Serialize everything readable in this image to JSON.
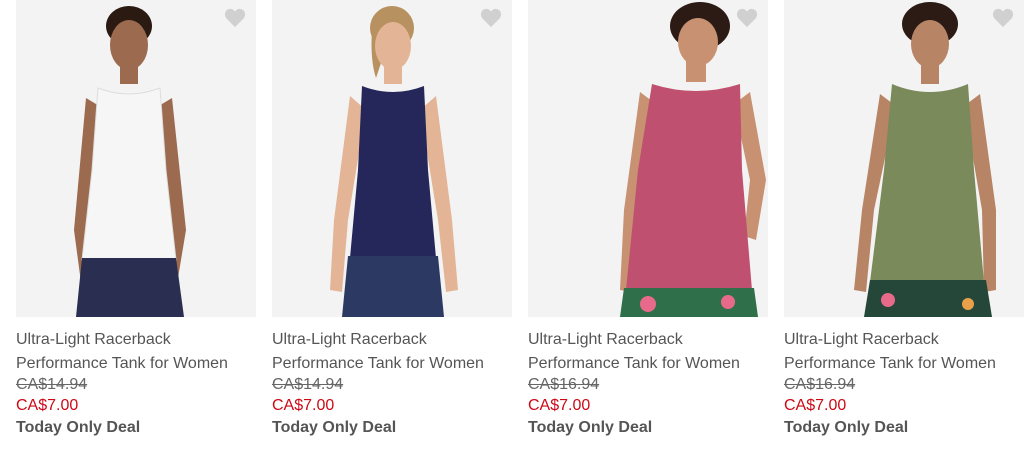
{
  "products": [
    {
      "name_line1": "Ultra-Light Racerback",
      "name_line2": "Performance Tank for Women",
      "was_price": "CA$14.94",
      "sale_price": "CA$7.00",
      "badge": "Today Only Deal",
      "tank_color": "#f6f6f6",
      "bottoms_color": "#2a2f52",
      "skin_color": "#9b6a4f",
      "hair_color": "#2a1a12"
    },
    {
      "name_line1": "Ultra-Light Racerback",
      "name_line2": "Performance Tank for Women",
      "was_price": "CA$14.94",
      "sale_price": "CA$7.00",
      "badge": "Today Only Deal",
      "tank_color": "#25275a",
      "bottoms_color": "#2c3a63",
      "skin_color": "#e3b596",
      "hair_color": "#b89160"
    },
    {
      "name_line1": "Ultra-Light Racerback",
      "name_line2": "Performance Tank for Women",
      "was_price": "CA$16.94",
      "sale_price": "CA$7.00",
      "badge": "Today Only Deal",
      "tank_color": "#c0506f",
      "bottoms_color": "#2f6f4a",
      "skin_color": "#c79172",
      "hair_color": "#2b1b14"
    },
    {
      "name_line1": "Ultra-Light Racerback",
      "name_line2": "Performance Tank for Women",
      "was_price": "CA$16.94",
      "sale_price": "CA$7.00",
      "badge": "Today Only Deal",
      "tank_color": "#7a8a5a",
      "bottoms_color": "#24473a",
      "skin_color": "#b78466",
      "hair_color": "#2b1b14"
    }
  ],
  "icons": {
    "favorite": "heart-icon"
  },
  "colors": {
    "sale_price": "#cc0a16",
    "heart": "#d0d0d0"
  }
}
